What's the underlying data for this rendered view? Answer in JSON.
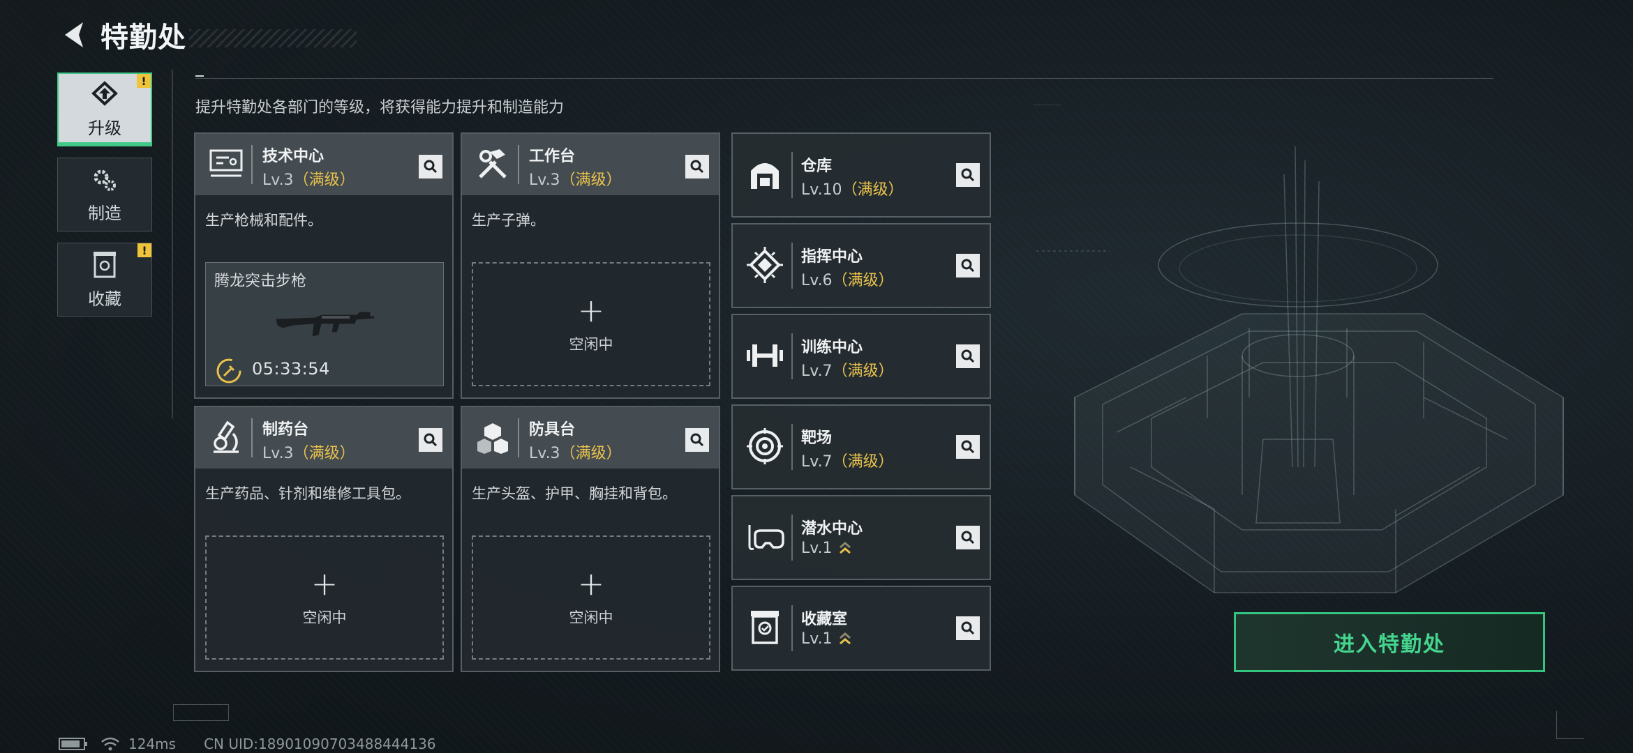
{
  "header": {
    "title": "特勤处"
  },
  "nav": [
    {
      "label": "升级",
      "icon": "upgrade-icon",
      "active": true,
      "alert": "!"
    },
    {
      "label": "制造",
      "icon": "craft-gears-icon",
      "active": false
    },
    {
      "label": "收藏",
      "icon": "collection-icon",
      "active": false,
      "alert": "!"
    }
  ],
  "subtitle": "提升特勤处各部门的等级，将获得能力提升和制造能力",
  "workshops": [
    {
      "name": "技术中心",
      "level": "Lv.3",
      "max": "（满级）",
      "desc": "生产枪械和配件。",
      "icon": "tech-center-icon",
      "craft": {
        "item": "腾龙突击步枪",
        "timer": "05:33:54"
      }
    },
    {
      "name": "工作台",
      "level": "Lv.3",
      "max": "（满级）",
      "desc": "生产子弹。",
      "icon": "workbench-tools-icon",
      "slot": {
        "plus": "+",
        "label": "空闲中"
      }
    },
    {
      "name": "制药台",
      "level": "Lv.3",
      "max": "（满级）",
      "desc": "生产药品、针剂和维修工具包。",
      "icon": "microscope-icon",
      "slot": {
        "plus": "+",
        "label": "空闲中"
      }
    },
    {
      "name": "防具台",
      "level": "Lv.3",
      "max": "（满级）",
      "desc": "生产头盔、护甲、胸挂和背包。",
      "icon": "armor-blocks-icon",
      "slot": {
        "plus": "+",
        "label": "空闲中"
      }
    }
  ],
  "facilities": [
    {
      "name": "仓库",
      "level": "Lv.10",
      "max": "（满级）",
      "icon": "warehouse-icon"
    },
    {
      "name": "指挥中心",
      "level": "Lv.6",
      "max": "（满级）",
      "icon": "command-chip-icon"
    },
    {
      "name": "训练中心",
      "level": "Lv.7",
      "max": "（满级）",
      "icon": "dumbbell-icon"
    },
    {
      "name": "靶场",
      "level": "Lv.7",
      "max": "（满级）",
      "icon": "target-icon"
    },
    {
      "name": "潜水中心",
      "level": "Lv.1",
      "max": "",
      "upgradable": true,
      "icon": "diving-mask-icon"
    },
    {
      "name": "收藏室",
      "level": "Lv.1",
      "max": "",
      "upgradable": true,
      "icon": "collection-room-icon"
    }
  ],
  "enter_button": "进入特勤处",
  "status": {
    "ping": "124ms",
    "uid": "CN UID:18901090703488444136"
  },
  "colors": {
    "accent": "#41c98a",
    "max_level": "#e9c14c",
    "alert": "#f0c43a"
  }
}
